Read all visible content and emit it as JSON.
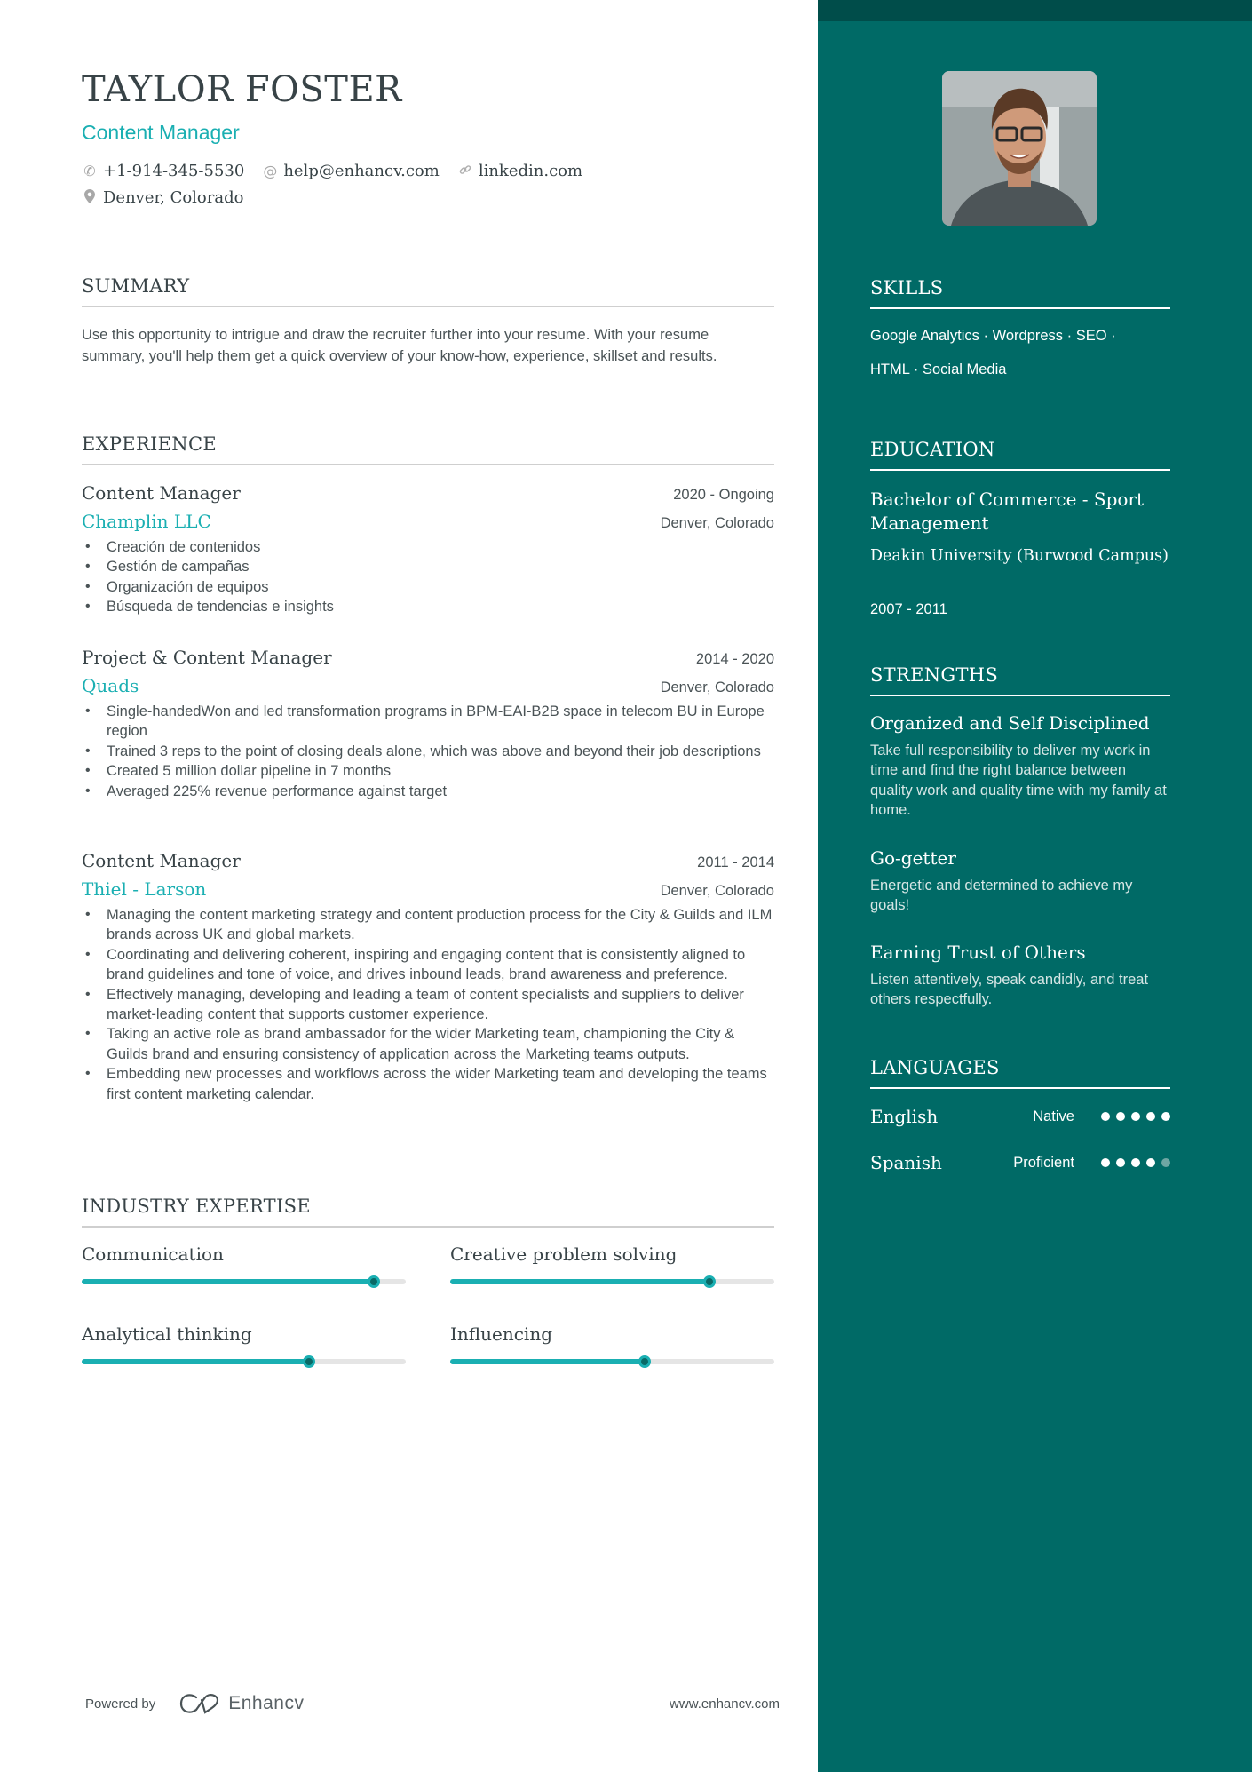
{
  "header": {
    "name": "TAYLOR FOSTER",
    "title": "Content Manager",
    "phone": "+1-914-345-5530",
    "email": "help@enhancv.com",
    "link": "linkedin.com",
    "location": "Denver, Colorado",
    "icons": {
      "phone": "phone-icon",
      "email": "at-icon",
      "link": "link-icon",
      "location": "map-pin-icon"
    }
  },
  "summary": {
    "title": "SUMMARY",
    "text": "Use this opportunity to intrigue and draw the recruiter further into your resume. With your resume summary, you'll help them get a quick overview of your know-how, experience, skillset and results."
  },
  "experience": {
    "title": "EXPERIENCE",
    "jobs": [
      {
        "title": "Content Manager",
        "dates": "2020 - Ongoing",
        "company": "Champlin LLC",
        "location": "Denver, Colorado",
        "bullets": [
          "Creación de contenidos",
          "Gestión de campañas",
          "Organización de equipos",
          "Búsqueda de tendencias e insights"
        ]
      },
      {
        "title": "Project & Content Manager",
        "dates": "2014 - 2020",
        "company": "Quads",
        "location": "Denver, Colorado",
        "bullets": [
          "Single-handedWon and led transformation programs in BPM-EAI-B2B space in telecom BU in Europe region",
          "Trained 3 reps to the point of closing deals alone, which was above and beyond their job descriptions",
          "Created 5 million dollar pipeline in 7 months",
          "Averaged 225% revenue performance against target"
        ]
      },
      {
        "title": "Content Manager",
        "dates": "2011 - 2014",
        "company": "Thiel - Larson",
        "location": "Denver, Colorado",
        "bullets": [
          "Managing the content marketing strategy and content production process for the City & Guilds and ILM brands across UK and global markets.",
          "Coordinating and delivering coherent, inspiring and engaging content that is consistently aligned to brand guidelines and tone of voice, and drives inbound leads, brand awareness and preference.",
          "Effectively managing, developing and leading a team of content specialists and suppliers to deliver market-leading content that supports customer experience.",
          "Taking an active role as brand ambassador for the wider Marketing team, championing the City & Guilds brand and ensuring consistency of application across the Marketing teams outputs.",
          "Embedding new processes and workflows across the wider Marketing team and developing the teams first content marketing calendar."
        ]
      }
    ]
  },
  "expertise": {
    "title": "INDUSTRY EXPERTISE",
    "items": [
      {
        "label": "Communication",
        "level": 0.9
      },
      {
        "label": "Creative problem solving",
        "level": 0.8
      },
      {
        "label": "Analytical thinking",
        "level": 0.7
      },
      {
        "label": "Influencing",
        "level": 0.6
      }
    ]
  },
  "footer": {
    "powered_by": "Powered by",
    "brand": "Enhancv",
    "website": "www.enhancv.com"
  },
  "sidebar": {
    "skills": {
      "title": "SKILLS",
      "line1": "Google Analytics · Wordpress · SEO ·",
      "line2": "HTML · Social Media"
    },
    "education": {
      "title": "EDUCATION",
      "degree": "Bachelor of Commerce - Sport Management",
      "school": "Deakin University (Burwood Campus)",
      "dates": "2007 - 2011"
    },
    "strengths": {
      "title": "STRENGTHS",
      "items": [
        {
          "title": "Organized and Self Disciplined",
          "desc": "Take full responsibility to deliver my work in time and find the right balance between quality work and quality time with my family at home."
        },
        {
          "title": "Go-getter",
          "desc": "Energetic and determined to achieve my goals!"
        },
        {
          "title": "Earning Trust of Others",
          "desc": "Listen attentively, speak candidly, and treat others respectfully."
        }
      ]
    },
    "languages": {
      "title": "LANGUAGES",
      "items": [
        {
          "name": "English",
          "level": "Native",
          "dots": 5,
          "max": 5
        },
        {
          "name": "Spanish",
          "level": "Proficient",
          "dots": 4,
          "max": 5
        }
      ]
    }
  },
  "colors": {
    "accent": "#1aafb2",
    "sidebar": "#006a66",
    "sidebar_band": "#004d4a",
    "text": "#384347"
  }
}
